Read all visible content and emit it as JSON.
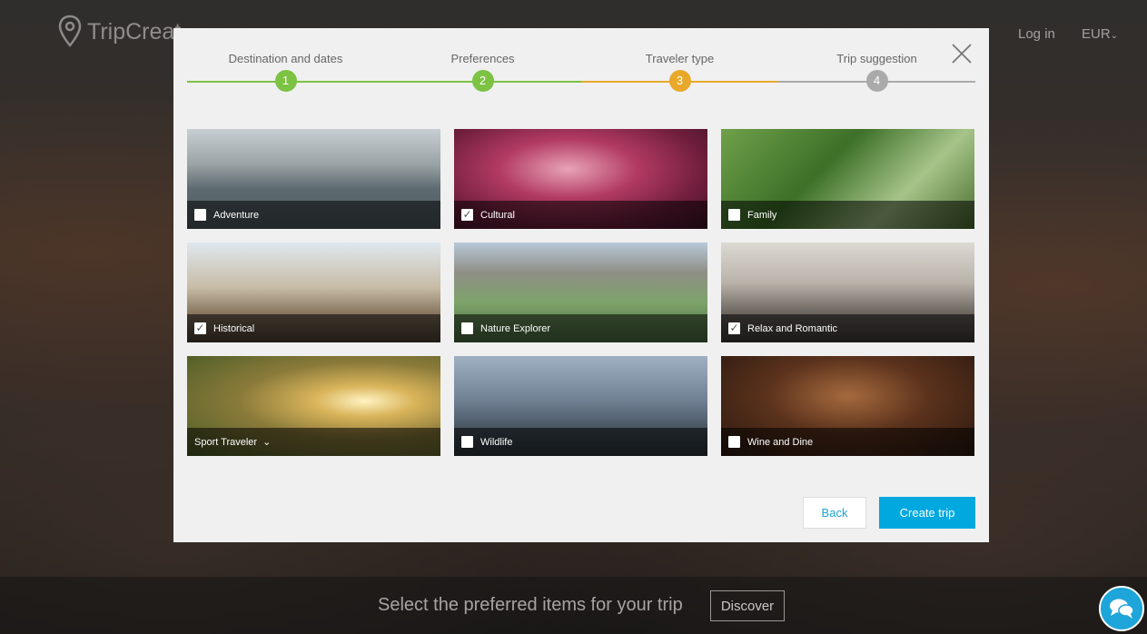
{
  "header": {
    "logo_text": "TripCreat",
    "login_label": "Log in",
    "currency_label": "EUR"
  },
  "steps": [
    {
      "label": "Destination and dates",
      "number": "1",
      "state": "done"
    },
    {
      "label": "Preferences",
      "number": "2",
      "state": "done"
    },
    {
      "label": "Traveler type",
      "number": "3",
      "state": "active"
    },
    {
      "label": "Trip suggestion",
      "number": "4",
      "state": "pending"
    }
  ],
  "colors": {
    "done": "#7cc243",
    "active": "#e8a92a",
    "pending": "#aaaaaa",
    "primary": "#00a8e0"
  },
  "traveler_types": [
    {
      "label": "Adventure",
      "checked": false,
      "has_dropdown": false
    },
    {
      "label": "Cultural",
      "checked": true,
      "has_dropdown": false
    },
    {
      "label": "Family",
      "checked": false,
      "has_dropdown": false
    },
    {
      "label": "Historical",
      "checked": true,
      "has_dropdown": false
    },
    {
      "label": "Nature Explorer",
      "checked": false,
      "has_dropdown": false
    },
    {
      "label": "Relax and Romantic",
      "checked": true,
      "has_dropdown": false
    },
    {
      "label": "Sport Traveler",
      "checked": false,
      "has_dropdown": true
    },
    {
      "label": "Wildlife",
      "checked": false,
      "has_dropdown": false
    },
    {
      "label": "Wine and Dine",
      "checked": false,
      "has_dropdown": false
    }
  ],
  "buttons": {
    "back_label": "Back",
    "create_label": "Create trip"
  },
  "footer": {
    "text": "Select the preferred items for your trip",
    "discover_label": "Discover"
  }
}
